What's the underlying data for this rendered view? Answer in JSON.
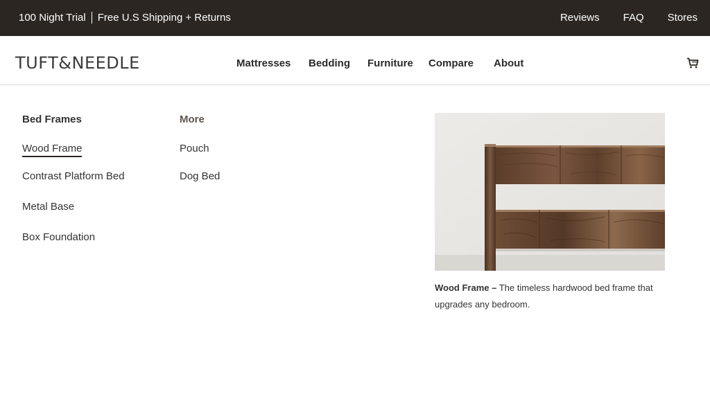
{
  "promo": {
    "trial": "100 Night Trial",
    "shipping": "Free U.S Shipping + Returns"
  },
  "top_links": [
    "Reviews",
    "FAQ",
    "Stores"
  ],
  "logo": {
    "text": "TUFT&NEEDLE"
  },
  "nav": [
    "Mattresses",
    "Bedding",
    "Furniture",
    "Compare",
    "About"
  ],
  "cart": {
    "icon": "cart-icon"
  },
  "menu": {
    "bed_frames": {
      "heading": "Bed Frames",
      "items": [
        "Wood Frame",
        "Contrast Platform Bed",
        "Metal Base",
        "Box Foundation"
      ]
    },
    "more": {
      "heading": "More",
      "items": [
        "Pouch",
        "Dog Bed"
      ]
    }
  },
  "feature": {
    "title": "Wood Frame –",
    "description": "The timeless hardwood bed frame that upgrades any bedroom."
  },
  "colors": {
    "topbar_bg": "#2b2622",
    "text": "#333333",
    "wood": "#6b4a33"
  }
}
